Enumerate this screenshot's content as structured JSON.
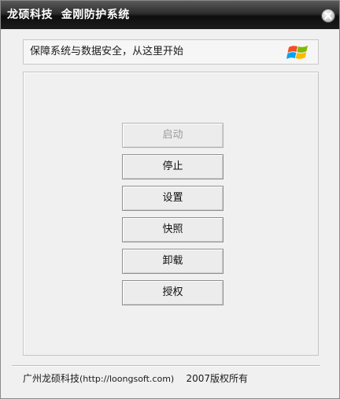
{
  "window": {
    "title": "龙硕科技  金刚防护系统",
    "close_icon": "close-icon"
  },
  "banner": {
    "text": "保障系统与数据安全，从这里开始",
    "icon": "windows-flag-icon"
  },
  "actions": [
    {
      "label": "启动",
      "enabled": false
    },
    {
      "label": "停止",
      "enabled": true
    },
    {
      "label": "设置",
      "enabled": true
    },
    {
      "label": "快照",
      "enabled": true
    },
    {
      "label": "卸载",
      "enabled": true
    },
    {
      "label": "授权",
      "enabled": true
    }
  ],
  "footer": {
    "company": "广州龙硕科技",
    "url": "(http://loongsoft.com)",
    "copyright": "2007版权所有"
  }
}
